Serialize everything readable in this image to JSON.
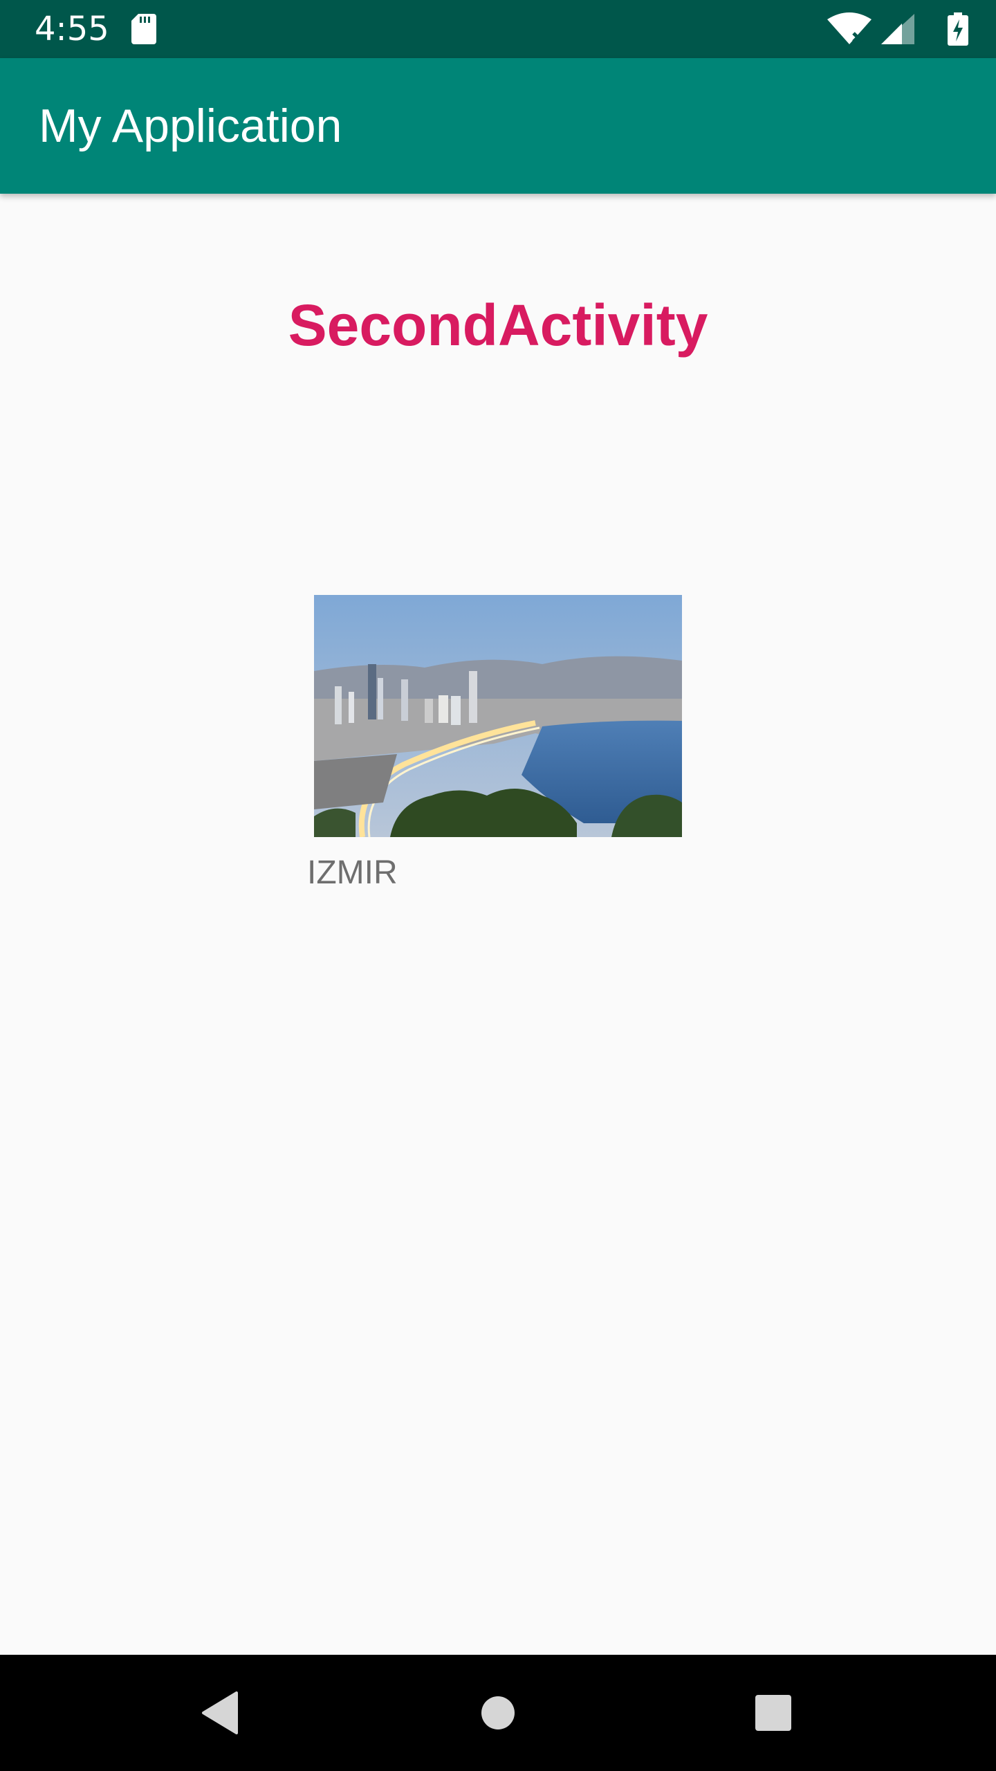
{
  "status_bar": {
    "time": "4:55",
    "icons": [
      "sd-card-icon",
      "wifi-off-icon",
      "cell-signal-icon",
      "battery-charging-icon"
    ]
  },
  "app_bar": {
    "title": "My Application"
  },
  "main": {
    "activity_title": "SecondActivity",
    "image_label": "IZMIR"
  },
  "nav_bar": {
    "buttons": [
      "back-icon",
      "home-icon",
      "recents-icon"
    ]
  },
  "colors": {
    "status_bar": "#00574b",
    "app_bar": "#008577",
    "accent": "#d81b60",
    "background": "#fafafa",
    "label_text": "#6e6e6e"
  }
}
